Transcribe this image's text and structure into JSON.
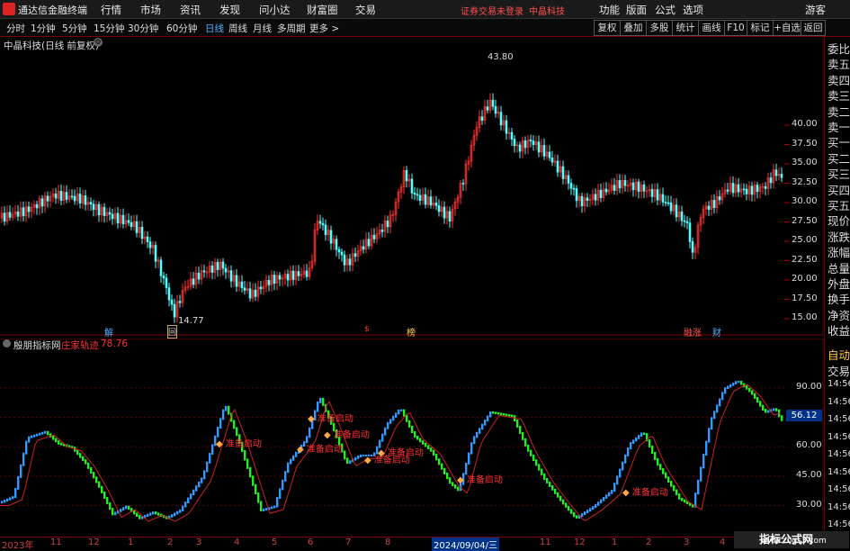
{
  "app": {
    "title": "通达信金融终端",
    "menu": [
      "行情",
      "市场",
      "资讯",
      "发现",
      "问小达",
      "财富圈",
      "交易"
    ],
    "warning": "证券交易未登录",
    "stock_tab": "中晶科技",
    "menu_right": [
      "功能",
      "版面",
      "公式",
      "选项"
    ],
    "user": "游客"
  },
  "periods": [
    "分时",
    "1分钟",
    "5分钟",
    "15分钟",
    "30分钟",
    "60分钟",
    "日线",
    "周线",
    "月线",
    "多周期",
    "更多 >"
  ],
  "active_period": "日线",
  "toolbar_right": [
    "复权",
    "叠加",
    "多股",
    "统计",
    "画线",
    "F10",
    "标记",
    "+自选",
    "返回"
  ],
  "main_chart": {
    "title": "中晶科技(日线 前复权)",
    "high_label": "43.80",
    "low_label": "14.77",
    "yticks": [
      "40.00",
      "37.50",
      "35.00",
      "32.50",
      "30.00",
      "27.50",
      "25.00",
      "22.50",
      "20.00",
      "17.50",
      "15.00"
    ],
    "markers": [
      "解",
      "回",
      "$",
      "榜",
      "融涨",
      "财"
    ]
  },
  "sub_chart": {
    "title": "殷朋指标网",
    "line_name": "庄家轨迹",
    "line_value": "78.76",
    "current_value": "56.12",
    "signal_text": "准备启动",
    "yticks": [
      "90.00",
      "75.00",
      "60.00",
      "45.00",
      "30.00"
    ]
  },
  "right_panel": {
    "items": [
      "委比",
      "卖五",
      "卖四",
      "卖三",
      "卖二",
      "卖一",
      "买一",
      "买二",
      "买三",
      "买四",
      "买五",
      "现价",
      "涨跌",
      "涨幅",
      "总量",
      "外盘",
      "换手",
      "净资",
      "收益"
    ],
    "auto": "自动",
    "trade": "交易",
    "times": [
      "14:56",
      "14:56",
      "14:56",
      "14:56",
      "14:56",
      "14:56",
      "14:56",
      "14:56",
      "14:56"
    ]
  },
  "bottom_axis": {
    "labels": [
      "2023年",
      "11",
      "12",
      "1",
      "2",
      "3",
      "4",
      "5",
      "6",
      "7",
      "8",
      "2024/09/04/三",
      "11",
      "12",
      "1",
      "2",
      "3",
      "4",
      "5"
    ]
  },
  "watermark": {
    "text": "指标公式网",
    "url": "www.zbgs3.com"
  },
  "colors": {
    "up": "#ff3333",
    "down": "#54ffff",
    "rise_bar": "#3399ff",
    "fall_bar": "#22ee22",
    "line": "#cc2222",
    "accent": "#4fb0ff"
  }
}
